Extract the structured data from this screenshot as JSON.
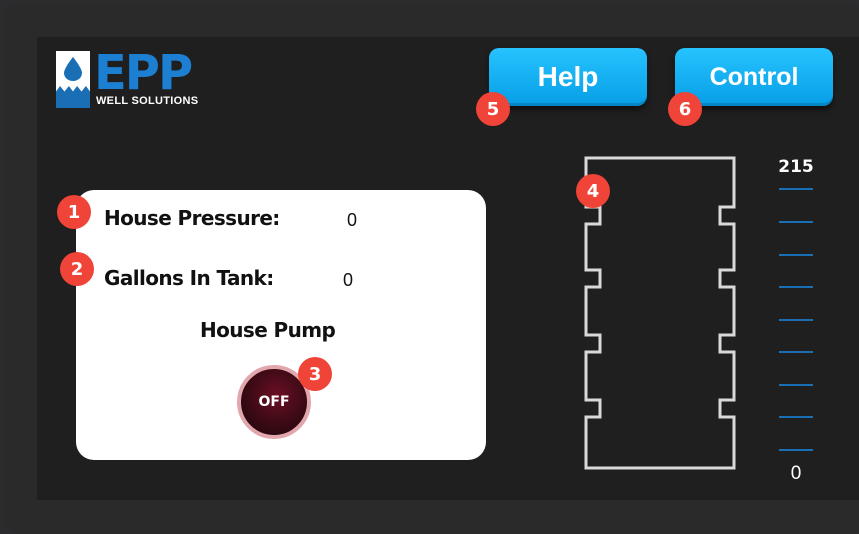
{
  "header": {
    "logo": {
      "main": "EPP",
      "sub": "WELL SOLUTIONS"
    },
    "help_label": "Help",
    "control_label": "Control"
  },
  "status": {
    "pressure_label": "House Pressure:",
    "pressure_value": "0",
    "gallons_label": "Gallons In Tank:",
    "gallons_value": "0",
    "pump_title": "House Pump",
    "pump_state": "OFF"
  },
  "tank_scale": {
    "max": "215",
    "min": "0",
    "level": 0
  },
  "markers": [
    "1",
    "2",
    "3",
    "4",
    "5",
    "6"
  ],
  "colors": {
    "accent": "#0ea7ee",
    "brand": "#1c7fd1",
    "badge": "#ef4437",
    "pump_off": "#3a0a14"
  }
}
